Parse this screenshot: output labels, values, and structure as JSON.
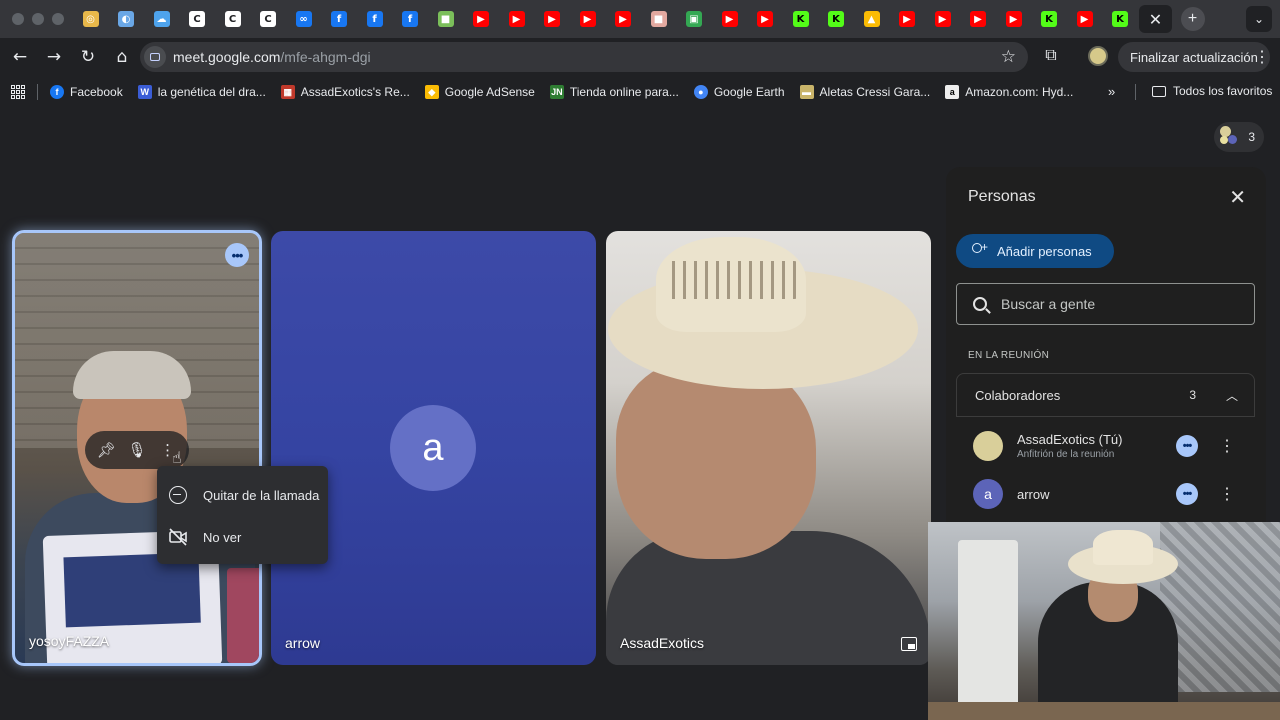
{
  "browser": {
    "tab_favicons": [
      {
        "icon": "chrome-icon",
        "color": "#e8b84a"
      },
      {
        "icon": "panorama-icon",
        "color": "#6aa7e6"
      },
      {
        "icon": "cloud-icon",
        "color": "#4ea3ec"
      },
      {
        "icon": "c-icon",
        "color": "#ffffff"
      },
      {
        "icon": "c-icon",
        "color": "#ffffff"
      },
      {
        "icon": "c-icon",
        "color": "#ffffff"
      },
      {
        "icon": "meta-icon",
        "color": "#1877f2"
      },
      {
        "icon": "facebook-icon",
        "color": "#1877f2"
      },
      {
        "icon": "facebook-icon",
        "color": "#1877f2"
      },
      {
        "icon": "facebook-icon",
        "color": "#1877f2"
      },
      {
        "icon": "generic-icon",
        "color": "#7bbf5a"
      },
      {
        "icon": "youtube-icon",
        "color": "#ff0000"
      },
      {
        "icon": "youtube-icon",
        "color": "#ff0000"
      },
      {
        "icon": "youtube-icon",
        "color": "#ff0000"
      },
      {
        "icon": "youtube-icon",
        "color": "#ff0000"
      },
      {
        "icon": "youtube-icon",
        "color": "#ff0000"
      },
      {
        "icon": "generic-icon",
        "color": "#e3a9a0"
      },
      {
        "icon": "meet-icon",
        "color": "#34a853"
      },
      {
        "icon": "youtube-icon",
        "color": "#ff0000"
      },
      {
        "icon": "youtube-icon",
        "color": "#ff0000"
      },
      {
        "icon": "k-icon",
        "color": "#53fc18"
      },
      {
        "icon": "k-icon",
        "color": "#53fc18"
      },
      {
        "icon": "drive-icon",
        "color": "#fbbc04"
      },
      {
        "icon": "youtube-icon",
        "color": "#ff0000"
      },
      {
        "icon": "youtube-icon",
        "color": "#ff0000"
      },
      {
        "icon": "youtube-icon",
        "color": "#ff0000"
      },
      {
        "icon": "youtube-icon",
        "color": "#ff0000"
      },
      {
        "icon": "k-icon",
        "color": "#53fc18"
      },
      {
        "icon": "youtube-icon",
        "color": "#ff0000"
      },
      {
        "icon": "k-icon",
        "color": "#53fc18"
      }
    ],
    "active_tab_icon": "close-icon",
    "url_host": "meet.google.com",
    "url_path": "/mfe-ahgm-dgi",
    "update_label": "Finalizar actualización",
    "bookmarks": [
      {
        "label": "Facebook",
        "icon": "facebook-icon",
        "color": "#1877f2",
        "glyph": "f"
      },
      {
        "label": "la genética del dra...",
        "icon": "w-icon",
        "color": "#3b5dd6",
        "glyph": "W"
      },
      {
        "label": "AssadExotics's Re...",
        "icon": "channel-icon",
        "color": "#c0392b",
        "glyph": "▦"
      },
      {
        "label": "Google AdSense",
        "icon": "adsense-icon",
        "color": "#fbbc04",
        "glyph": "◆"
      },
      {
        "label": "Tienda online para...",
        "icon": "store-icon",
        "color": "#2e7d32",
        "glyph": "JN"
      },
      {
        "label": "Google Earth",
        "icon": "earth-icon",
        "color": "#4285f4",
        "glyph": "●"
      },
      {
        "label": "Aletas Cressi Gara...",
        "icon": "fins-icon",
        "color": "#c9b46a",
        "glyph": "▬"
      },
      {
        "label": "Amazon.com: Hyd...",
        "icon": "amazon-icon",
        "color": "#eeeeee",
        "glyph": "a"
      }
    ],
    "all_bookmarks_label": "Todos los favoritos"
  },
  "meet": {
    "participant_count": "3",
    "tiles": [
      {
        "name": "yosoyFAZZA"
      },
      {
        "name": "arrow",
        "initial": "a"
      },
      {
        "name": "AssadExotics"
      }
    ],
    "context_menu": [
      {
        "label": "Quitar de la llamada",
        "icon": "remove-circle-icon"
      },
      {
        "label": "No ver",
        "icon": "videocam-off-icon"
      }
    ],
    "panel": {
      "title": "Personas",
      "add_label": "Añadir personas",
      "search_placeholder": "Buscar a gente",
      "section_label": "EN LA REUNIÓN",
      "group_title": "Colaboradores",
      "group_count": "3",
      "people": [
        {
          "name": "AssadExotics (Tú)",
          "subtitle": "Anfitrión de la reunión",
          "avatar_color": "#d9cf9a"
        },
        {
          "name": "arrow",
          "initial": "a",
          "avatar_color": "#5c64b8"
        }
      ]
    },
    "colors": {
      "accent": "#a8c7fa",
      "add_button": "#0f4a83",
      "arrow_tile": "#3544a2"
    }
  }
}
